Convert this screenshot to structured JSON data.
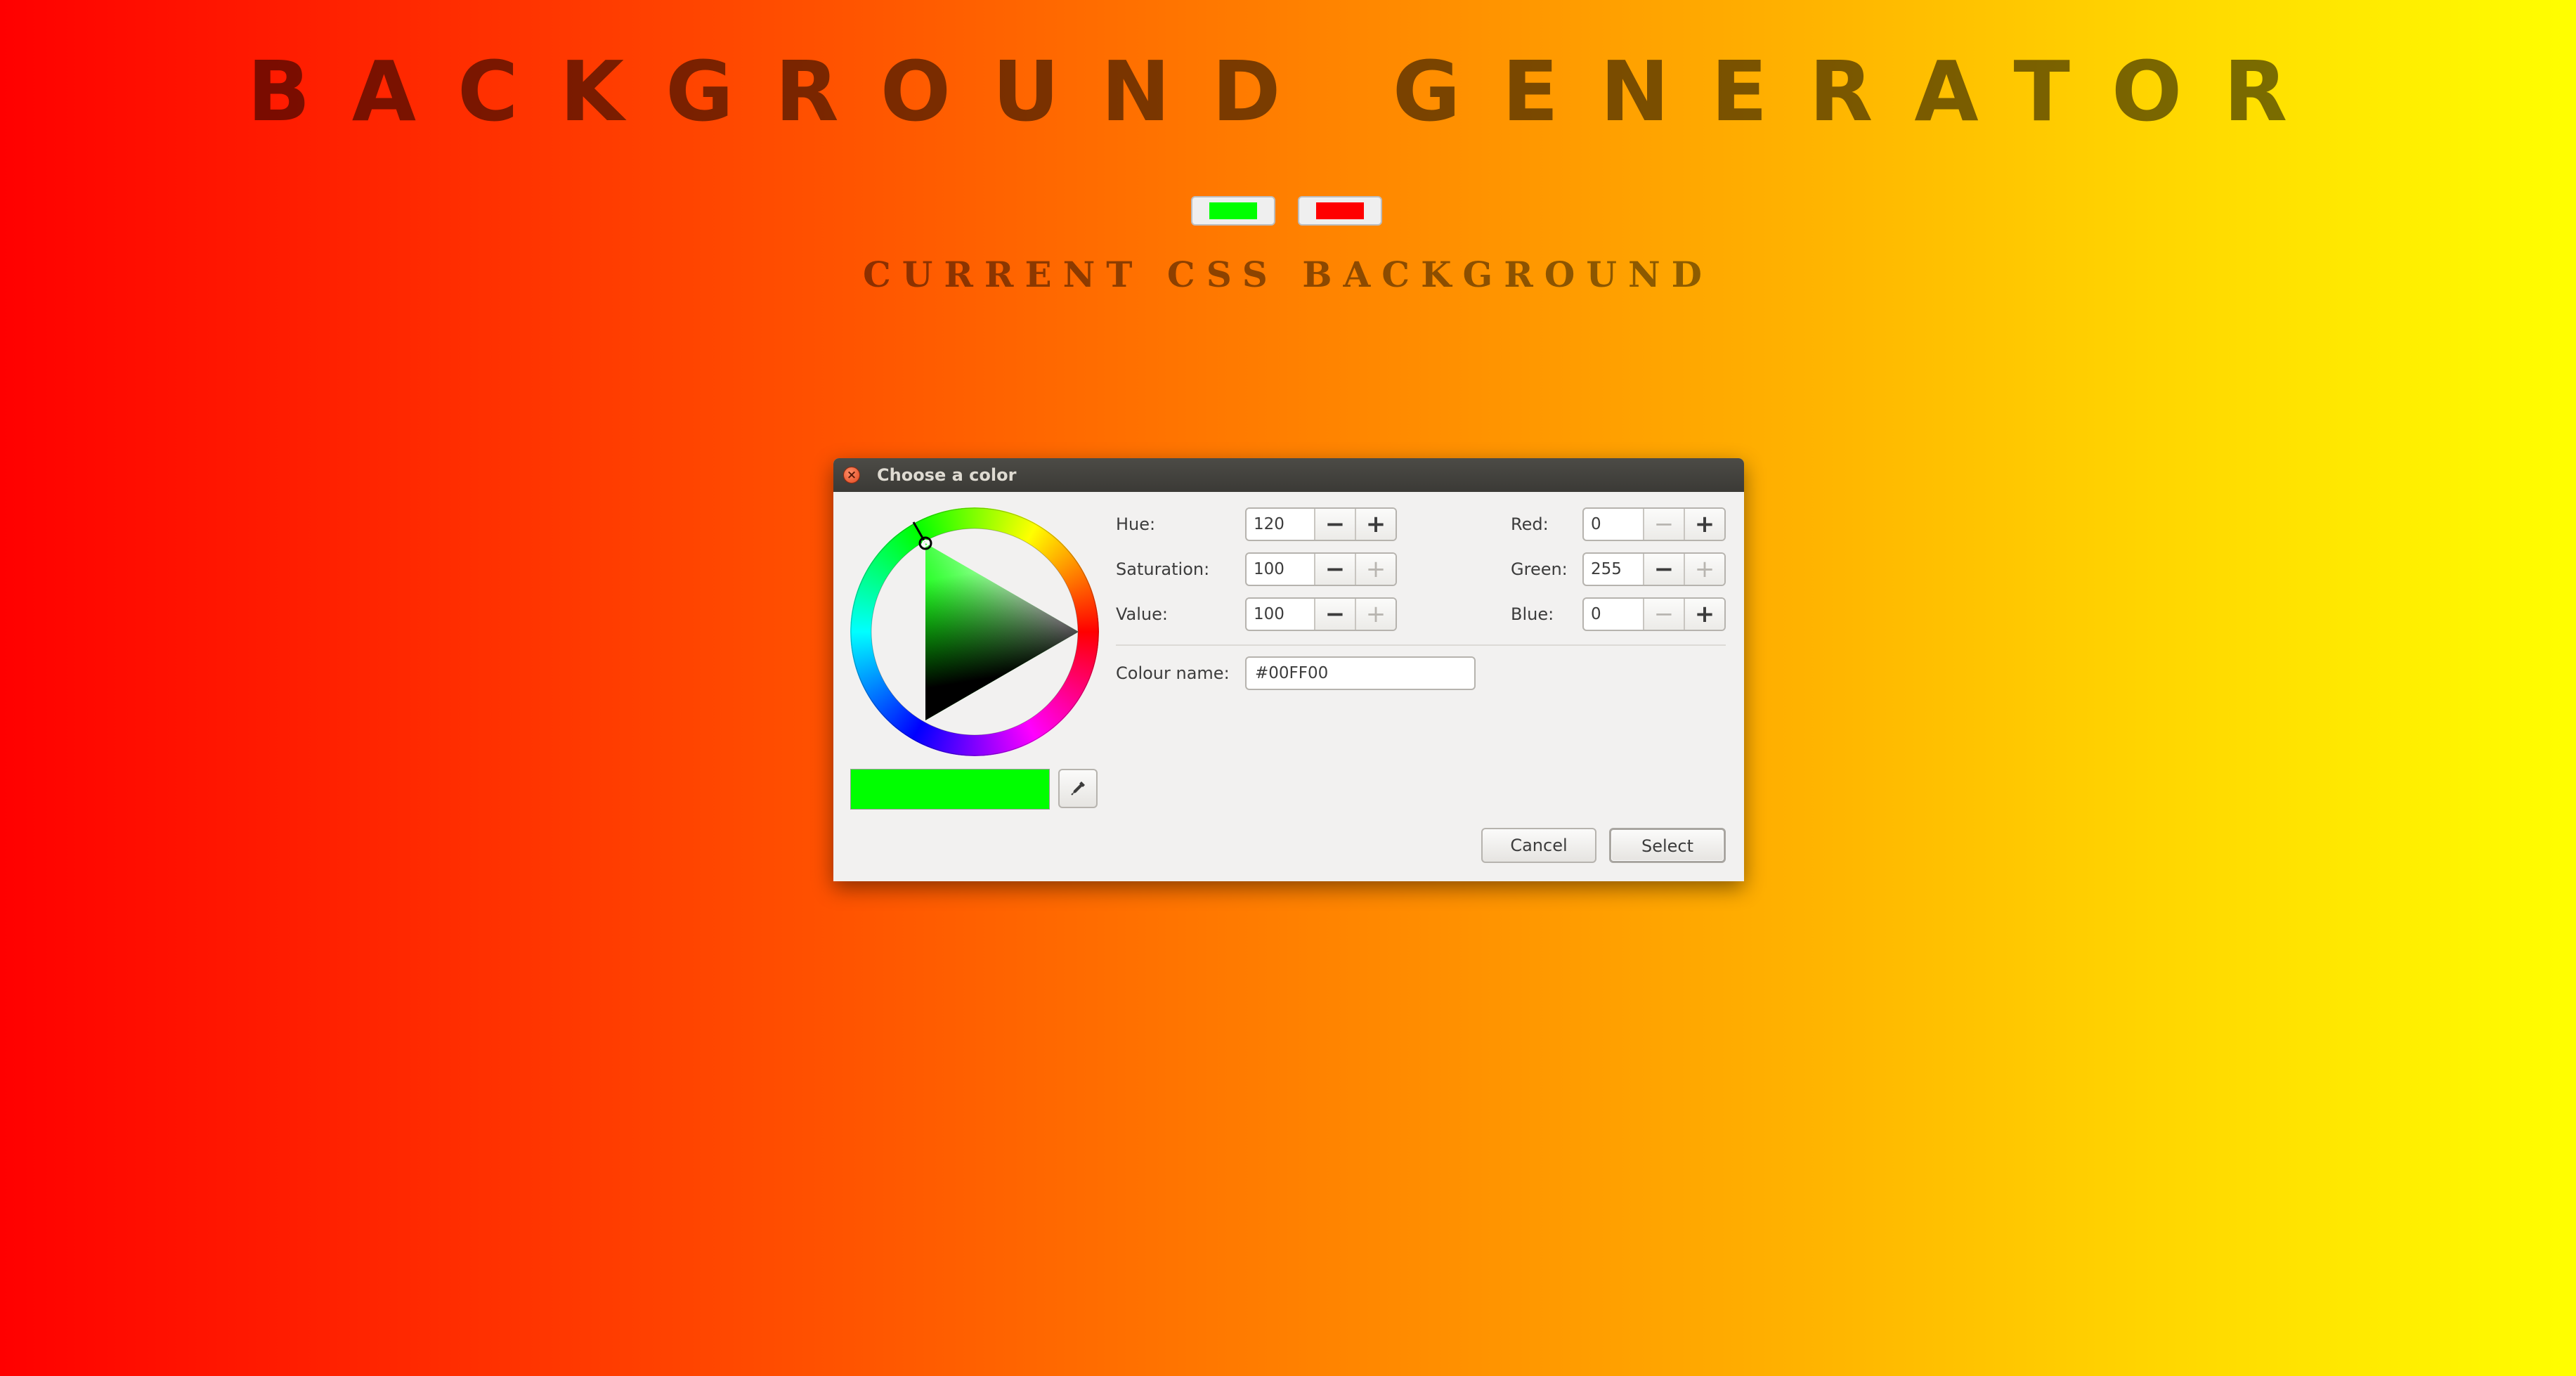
{
  "page": {
    "title": "BACKGROUND GENERATOR",
    "subtitle": "CURRENT CSS BACKGROUND",
    "color1": "#00ff00",
    "color2": "#ff0000",
    "gradient_start": "#ff0000",
    "gradient_end": "#ffff00"
  },
  "dialog": {
    "title": "Choose a color",
    "hue": {
      "label": "Hue:",
      "value": "120"
    },
    "saturation": {
      "label": "Saturation:",
      "value": "100"
    },
    "value": {
      "label": "Value:",
      "value": "100"
    },
    "red": {
      "label": "Red:",
      "value": "0"
    },
    "green": {
      "label": "Green:",
      "value": "255"
    },
    "blue": {
      "label": "Blue:",
      "value": "0"
    },
    "colour_name": {
      "label": "Colour name:",
      "value": "#00FF00"
    },
    "current_color": "#00ff00",
    "cancel_label": "Cancel",
    "select_label": "Select",
    "icons": {
      "close": "close-icon",
      "eyedropper": "eyedropper-icon",
      "minus": "−",
      "plus": "+"
    }
  }
}
